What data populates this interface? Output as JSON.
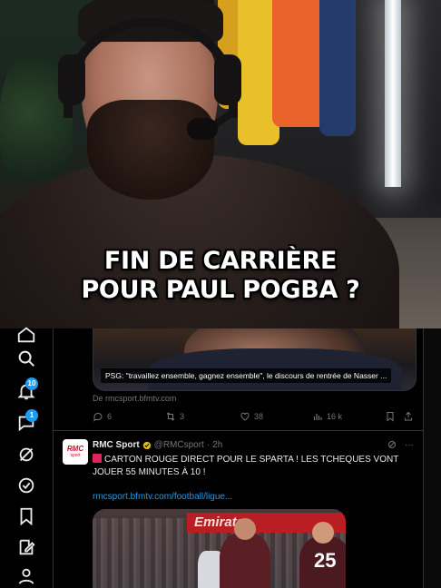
{
  "video": {
    "caption_line1": "FIN DE CARRIÈRE",
    "caption_line2": "POUR PAUL POGBA ?"
  },
  "leftnav": {
    "items": [
      {
        "icon": "home-icon"
      },
      {
        "icon": "search-icon"
      },
      {
        "icon": "notifications-bell-icon",
        "badge": "10"
      },
      {
        "icon": "messages-icon",
        "badge": "1"
      },
      {
        "icon": "grok-icon"
      },
      {
        "icon": "communities-icon"
      },
      {
        "icon": "bookmark-icon"
      },
      {
        "icon": "compose-icon"
      },
      {
        "icon": "profile-icon"
      }
    ]
  },
  "tweet1": {
    "media_caption": "PSG: \"travaillez ensemble, gagnez ensemble\", le discours de rentrée de Nasser ...",
    "source": "De rmcsport.bfmtv.com",
    "replies": "6",
    "retweets": "3",
    "likes": "38",
    "views": "16 k"
  },
  "tweet2": {
    "avatar_line1": "RMC",
    "avatar_line2": "sport",
    "name": "RMC Sport",
    "handle": "@RMCsport",
    "dot": "·",
    "time": "2h",
    "more": "···",
    "text": "CARTON ROUGE DIRECT POUR LE SPARTA ! LES TCHEQUES VONT JOUER 55 MINUTES À 10 !",
    "link": "rmcsport.bfmtv.com/football/ligue...",
    "media_banner": "Emirates",
    "player_number": "25"
  },
  "colors": {
    "accent": "#1d9bf0",
    "background": "#000000",
    "text": "#e7e9ea",
    "muted": "#71767b",
    "border": "#2f3336"
  }
}
